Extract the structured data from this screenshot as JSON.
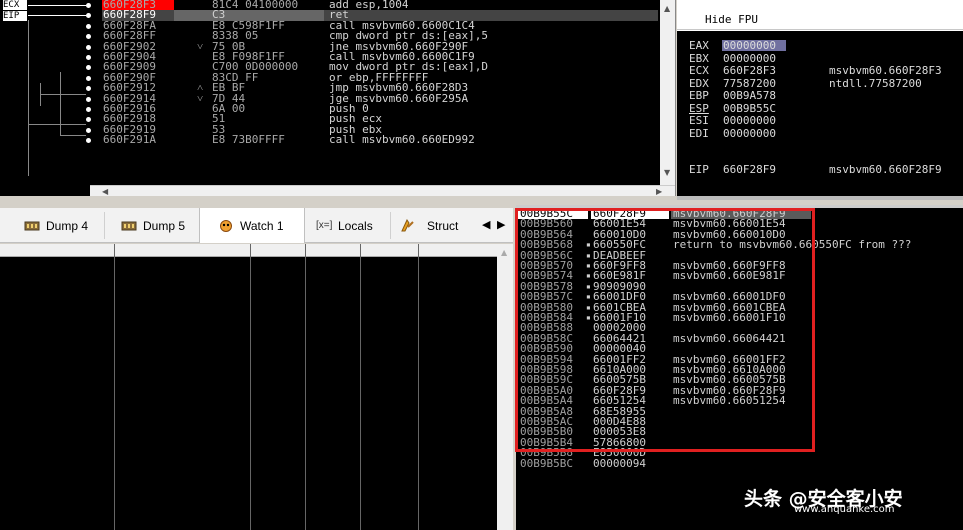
{
  "disasm": {
    "labels": {
      "ecx": "ECX",
      "eip": "EIP"
    },
    "rows": [
      {
        "addr": "660F28F3",
        "arrow": "",
        "hex": "81C4 04100000",
        "asm": "add esp,1004"
      },
      {
        "addr": "660F28F9",
        "arrow": "",
        "hex": "C3",
        "asm": "ret"
      },
      {
        "addr": "660F28FA",
        "arrow": "",
        "hex": "E8 C598F1FF",
        "asm": "call msvbvm60.6600C1C4"
      },
      {
        "addr": "660F28FF",
        "arrow": "",
        "hex": "8338 05",
        "asm": "cmp dword ptr ds:[eax],5"
      },
      {
        "addr": "660F2902",
        "arrow": "˅",
        "hex": "75 0B",
        "asm": "jne msvbvm60.660F290F"
      },
      {
        "addr": "660F2904",
        "arrow": "",
        "hex": "E8 F098F1FF",
        "asm": "call msvbvm60.6600C1F9"
      },
      {
        "addr": "660F2909",
        "arrow": "",
        "hex": "C700 0D000000",
        "asm": "mov dword ptr ds:[eax],D"
      },
      {
        "addr": "660F290F",
        "arrow": "",
        "hex": "83CD FF",
        "asm": "or ebp,FFFFFFFF"
      },
      {
        "addr": "660F2912",
        "arrow": "˄",
        "hex": "EB BF",
        "asm": "jmp msvbvm60.660F28D3"
      },
      {
        "addr": "660F2914",
        "arrow": "˅",
        "hex": "7D 44",
        "asm": "jge msvbvm60.660F295A"
      },
      {
        "addr": "660F2916",
        "arrow": "",
        "hex": "6A 00",
        "asm": "push 0"
      },
      {
        "addr": "660F2918",
        "arrow": "",
        "hex": "51",
        "asm": "push ecx"
      },
      {
        "addr": "660F2919",
        "arrow": "",
        "hex": "53",
        "asm": "push ebx"
      },
      {
        "addr": "660F291A",
        "arrow": "",
        "hex": "E8 73B0FFFF",
        "asm": "call msvbvm60.660ED992"
      }
    ]
  },
  "registers": {
    "header": "Hide FPU",
    "rows": [
      {
        "name": "EAX",
        "value": "00000000",
        "comment": ""
      },
      {
        "name": "EBX",
        "value": "00000000",
        "comment": ""
      },
      {
        "name": "ECX",
        "value": "660F28F3",
        "comment": "msvbvm60.660F28F3"
      },
      {
        "name": "EDX",
        "value": "77587200",
        "comment": "ntdll.77587200"
      },
      {
        "name": "EBP",
        "value": "00B9A578",
        "comment": ""
      },
      {
        "name": "ESP",
        "value": "00B9B55C",
        "comment": ""
      },
      {
        "name": "ESI",
        "value": "00000000",
        "comment": ""
      },
      {
        "name": "EDI",
        "value": "00000000",
        "comment": ""
      },
      {
        "name": "EIP",
        "value": "660F28F9",
        "comment": "msvbvm60.660F28F9"
      }
    ]
  },
  "tabs": [
    {
      "label": "Dump 4",
      "icon": "memory-icon"
    },
    {
      "label": "Dump 5",
      "icon": "memory-icon"
    },
    {
      "label": "Watch 1",
      "icon": "watch-icon"
    },
    {
      "label": "Locals",
      "icon": "locals-icon",
      "prefix": "[x=]"
    },
    {
      "label": "Struct",
      "icon": "struct-icon"
    }
  ],
  "stack": {
    "rows": [
      {
        "addr": "00B9B55C",
        "mark": "",
        "value": "660F28F9",
        "comment": "msvbvm60.660F28F9"
      },
      {
        "addr": "00B9B560",
        "mark": "",
        "value": "66001E54",
        "comment": "msvbvm60.66001E54"
      },
      {
        "addr": "00B9B564",
        "mark": "",
        "value": "660010D0",
        "comment": "msvbvm60.660010D0"
      },
      {
        "addr": "00B9B568",
        "mark": "▪",
        "value": "660550FC",
        "comment": "return to msvbvm60.660550FC from ???"
      },
      {
        "addr": "00B9B56C",
        "mark": "▪",
        "value": "DEADBEEF",
        "comment": ""
      },
      {
        "addr": "00B9B570",
        "mark": "▪",
        "value": "660F9FF8",
        "comment": "msvbvm60.660F9FF8"
      },
      {
        "addr": "00B9B574",
        "mark": "▪",
        "value": "660E981F",
        "comment": "msvbvm60.660E981F"
      },
      {
        "addr": "00B9B578",
        "mark": "▪",
        "value": "90909090",
        "comment": ""
      },
      {
        "addr": "00B9B57C",
        "mark": "▪",
        "value": "66001DF0",
        "comment": "msvbvm60.66001DF0"
      },
      {
        "addr": "00B9B580",
        "mark": "▪",
        "value": "6601CBEA",
        "comment": "msvbvm60.6601CBEA"
      },
      {
        "addr": "00B9B584",
        "mark": "▪",
        "value": "66001F10",
        "comment": "msvbvm60.66001F10"
      },
      {
        "addr": "00B9B588",
        "mark": "",
        "value": "00002000",
        "comment": ""
      },
      {
        "addr": "00B9B58C",
        "mark": "",
        "value": "66064421",
        "comment": "msvbvm60.66064421"
      },
      {
        "addr": "00B9B590",
        "mark": "",
        "value": "00000040",
        "comment": ""
      },
      {
        "addr": "00B9B594",
        "mark": "",
        "value": "66001FF2",
        "comment": "msvbvm60.66001FF2"
      },
      {
        "addr": "00B9B598",
        "mark": "",
        "value": "6610A000",
        "comment": "msvbvm60.6610A000"
      },
      {
        "addr": "00B9B59C",
        "mark": "",
        "value": "6600575B",
        "comment": "msvbvm60.6600575B"
      },
      {
        "addr": "00B9B5A0",
        "mark": "",
        "value": "660F28F9",
        "comment": "msvbvm60.660F28F9"
      },
      {
        "addr": "00B9B5A4",
        "mark": "",
        "value": "66051254",
        "comment": "msvbvm60.66051254"
      },
      {
        "addr": "00B9B5A8",
        "mark": "",
        "value": "68E58955",
        "comment": ""
      },
      {
        "addr": "00B9B5AC",
        "mark": "",
        "value": "000D4E88",
        "comment": ""
      },
      {
        "addr": "00B9B5B0",
        "mark": "",
        "value": "000053E8",
        "comment": ""
      },
      {
        "addr": "00B9B5B4",
        "mark": "",
        "value": "57866800",
        "comment": ""
      },
      {
        "addr": "00B9B5B8",
        "mark": "",
        "value": "E850000D",
        "comment": ""
      },
      {
        "addr": "00B9B5BC",
        "mark": "",
        "value": "00000094",
        "comment": ""
      }
    ]
  },
  "watermark": {
    "main": "头条 @安全客小安",
    "sub": "www.anquanke.com"
  },
  "colors": {
    "highlight_box": "#e02020",
    "current_address": "#ff0000"
  }
}
